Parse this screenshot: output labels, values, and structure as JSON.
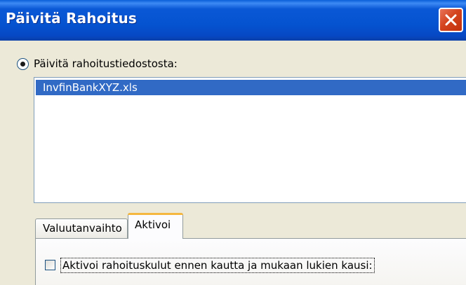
{
  "window": {
    "title": "Päivitä Rahoitus",
    "close_icon": "close-icon",
    "colors": {
      "titlebar": "#0553d0",
      "close_button": "#d4441f",
      "selection": "#316ac5",
      "background": "#ece9d8",
      "active_tab_highlight": "#f5b73f"
    }
  },
  "source": {
    "radio_label": "Päivitä rahoitustiedostosta:",
    "radio_checked": true,
    "files": [
      {
        "name": "InvfinBankXYZ.xls",
        "selected": true
      }
    ]
  },
  "tabs": [
    {
      "label": "Valuutanvaihto",
      "active": false
    },
    {
      "label": "Aktivoi",
      "active": true
    }
  ],
  "aktivoi_panel": {
    "checkbox_label": "Aktivoi rahoituskulut ennen kautta ja mukaan lukien kausi:",
    "checkbox_checked": false
  }
}
